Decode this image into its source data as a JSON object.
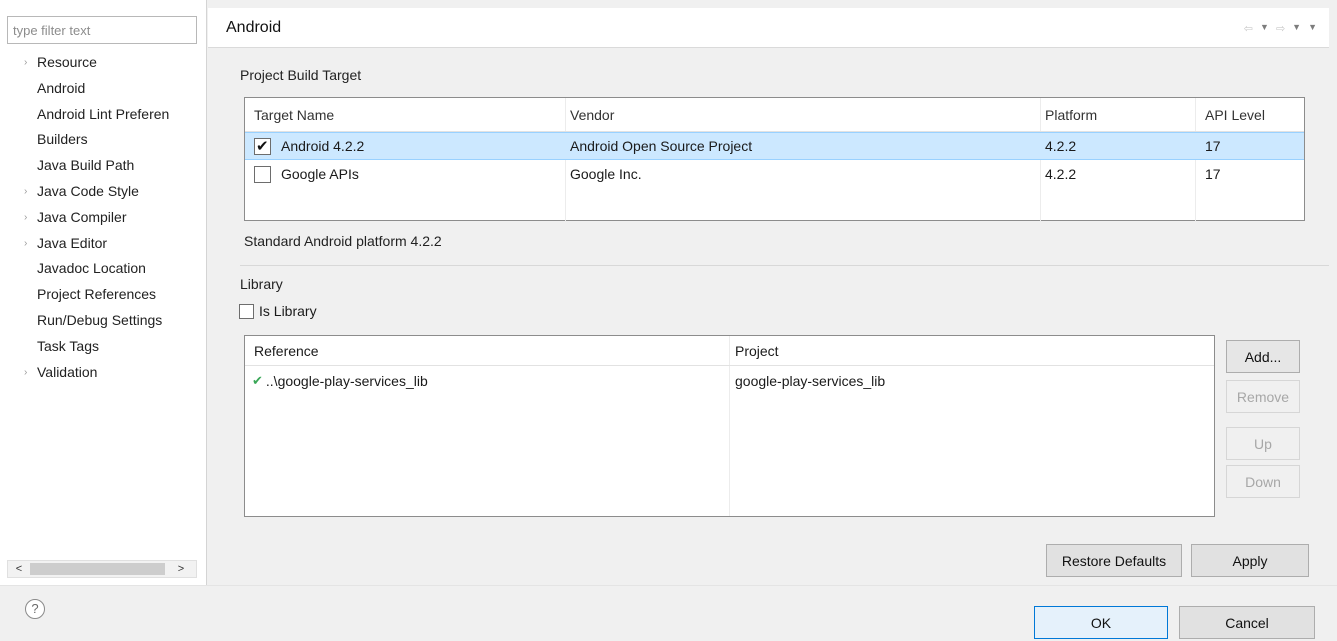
{
  "sidebar": {
    "filter_placeholder": "type filter text",
    "items": [
      {
        "label": "Resource",
        "expandable": true
      },
      {
        "label": "Android",
        "expandable": false
      },
      {
        "label": "Android Lint Preferen",
        "expandable": false
      },
      {
        "label": "Builders",
        "expandable": false
      },
      {
        "label": "Java Build Path",
        "expandable": false
      },
      {
        "label": "Java Code Style",
        "expandable": true
      },
      {
        "label": "Java Compiler",
        "expandable": true
      },
      {
        "label": "Java Editor",
        "expandable": true
      },
      {
        "label": "Javadoc Location",
        "expandable": false
      },
      {
        "label": "Project References",
        "expandable": false
      },
      {
        "label": "Run/Debug Settings",
        "expandable": false
      },
      {
        "label": "Task Tags",
        "expandable": false
      },
      {
        "label": "Validation",
        "expandable": true
      }
    ],
    "scroll_left": "<",
    "scroll_right": ">"
  },
  "page": {
    "title": "Android",
    "nav_icons": [
      "back-arrow-icon",
      "dropdown-icon",
      "forward-arrow-icon",
      "dropdown-icon",
      "view-menu-icon"
    ]
  },
  "build_target": {
    "group_label": "Project Build Target",
    "columns": {
      "name": "Target Name",
      "vendor": "Vendor",
      "platform": "Platform",
      "api": "API Level"
    },
    "rows": [
      {
        "name": "Android 4.2.2",
        "vendor": "Android Open Source Project",
        "platform": "4.2.2",
        "api": "17",
        "checked": true,
        "selected": true
      },
      {
        "name": "Google APIs",
        "vendor": "Google Inc.",
        "platform": "4.2.2",
        "api": "17",
        "checked": false,
        "selected": false
      }
    ],
    "description": "Standard Android platform 4.2.2"
  },
  "library": {
    "group_label": "Library",
    "is_library_label": "Is Library",
    "is_library_checked": false,
    "columns": {
      "reference": "Reference",
      "project": "Project"
    },
    "rows": [
      {
        "reference": "..\\google-play-services_lib",
        "project": "google-play-services_lib",
        "status_icon": "green-check-icon"
      }
    ],
    "buttons": {
      "add": "Add...",
      "remove": "Remove",
      "up": "Up",
      "down": "Down"
    }
  },
  "actions": {
    "restore_defaults": "Restore Defaults",
    "apply": "Apply"
  },
  "footer": {
    "ok": "OK",
    "cancel": "Cancel",
    "help": "?"
  },
  "colors": {
    "selection": "#cce8ff",
    "default_button_border": "#0078d7",
    "ok_check": "#3aa757"
  }
}
